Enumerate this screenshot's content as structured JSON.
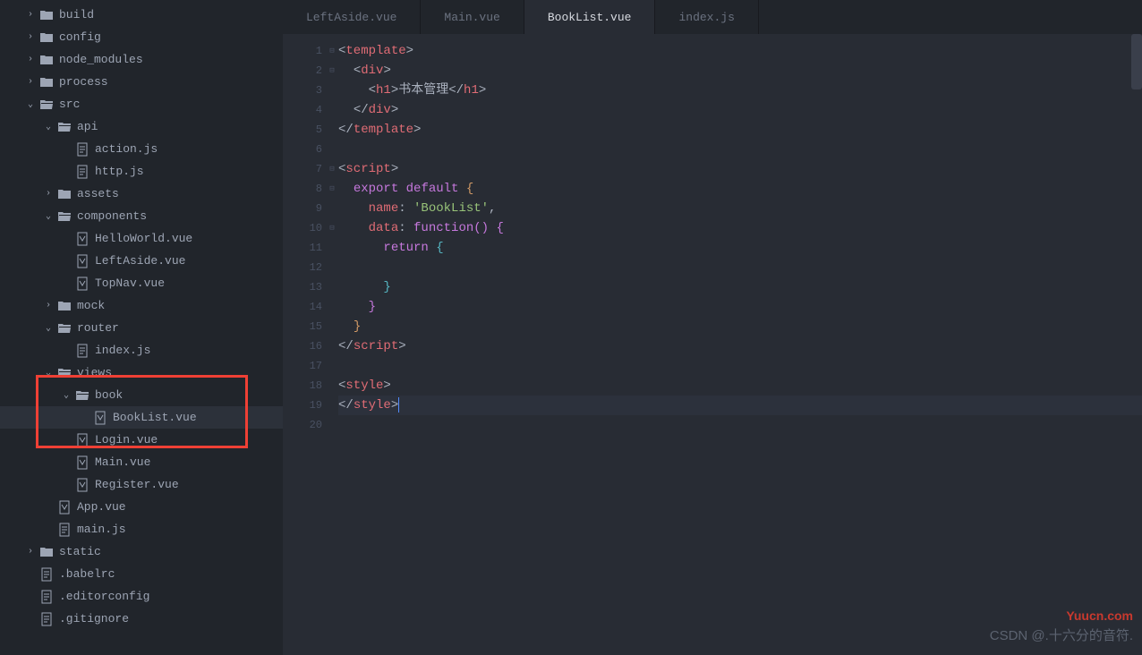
{
  "sidebar": {
    "tree": [
      {
        "indent": 28,
        "chev": "›",
        "icon": "folder",
        "label": "build"
      },
      {
        "indent": 28,
        "chev": "›",
        "icon": "folder",
        "label": "config"
      },
      {
        "indent": 28,
        "chev": "›",
        "icon": "folder",
        "label": "node_modules"
      },
      {
        "indent": 28,
        "chev": "›",
        "icon": "folder",
        "label": "process"
      },
      {
        "indent": 28,
        "chev": "⌄",
        "icon": "folder-open",
        "label": "src"
      },
      {
        "indent": 48,
        "chev": "⌄",
        "icon": "folder-open",
        "label": "api"
      },
      {
        "indent": 68,
        "chev": "",
        "icon": "file",
        "label": "action.js"
      },
      {
        "indent": 68,
        "chev": "",
        "icon": "file",
        "label": "http.js"
      },
      {
        "indent": 48,
        "chev": "›",
        "icon": "folder",
        "label": "assets"
      },
      {
        "indent": 48,
        "chev": "⌄",
        "icon": "folder-open",
        "label": "components"
      },
      {
        "indent": 68,
        "chev": "",
        "icon": "vue",
        "label": "HelloWorld.vue"
      },
      {
        "indent": 68,
        "chev": "",
        "icon": "vue",
        "label": "LeftAside.vue"
      },
      {
        "indent": 68,
        "chev": "",
        "icon": "vue",
        "label": "TopNav.vue"
      },
      {
        "indent": 48,
        "chev": "›",
        "icon": "folder",
        "label": "mock"
      },
      {
        "indent": 48,
        "chev": "⌄",
        "icon": "folder-open",
        "label": "router"
      },
      {
        "indent": 68,
        "chev": "",
        "icon": "file",
        "label": "index.js"
      },
      {
        "indent": 48,
        "chev": "⌄",
        "icon": "folder-open",
        "label": "views"
      },
      {
        "indent": 68,
        "chev": "⌄",
        "icon": "folder-open",
        "label": "book"
      },
      {
        "indent": 88,
        "chev": "",
        "icon": "vue",
        "label": "BookList.vue",
        "active": true
      },
      {
        "indent": 68,
        "chev": "",
        "icon": "vue",
        "label": "Login.vue"
      },
      {
        "indent": 68,
        "chev": "",
        "icon": "vue",
        "label": "Main.vue"
      },
      {
        "indent": 68,
        "chev": "",
        "icon": "vue",
        "label": "Register.vue"
      },
      {
        "indent": 48,
        "chev": "",
        "icon": "vue",
        "label": "App.vue"
      },
      {
        "indent": 48,
        "chev": "",
        "icon": "file",
        "label": "main.js"
      },
      {
        "indent": 28,
        "chev": "›",
        "icon": "folder",
        "label": "static"
      },
      {
        "indent": 28,
        "chev": "",
        "icon": "file",
        "label": ".babelrc"
      },
      {
        "indent": 28,
        "chev": "",
        "icon": "file",
        "label": ".editorconfig"
      },
      {
        "indent": 28,
        "chev": "",
        "icon": "file",
        "label": ".gitignore"
      }
    ]
  },
  "tabs": [
    {
      "label": "LeftAside.vue",
      "active": false
    },
    {
      "label": "Main.vue",
      "active": false
    },
    {
      "label": "BookList.vue",
      "active": true
    },
    {
      "label": "index.js",
      "active": false
    }
  ],
  "code": {
    "lines": 20,
    "text": {
      "h1_content": "书本管理",
      "name_value": "'BookList'"
    }
  },
  "watermarks": {
    "top": "Yuucn.com",
    "bottom": "CSDN @.十六分的音符."
  }
}
